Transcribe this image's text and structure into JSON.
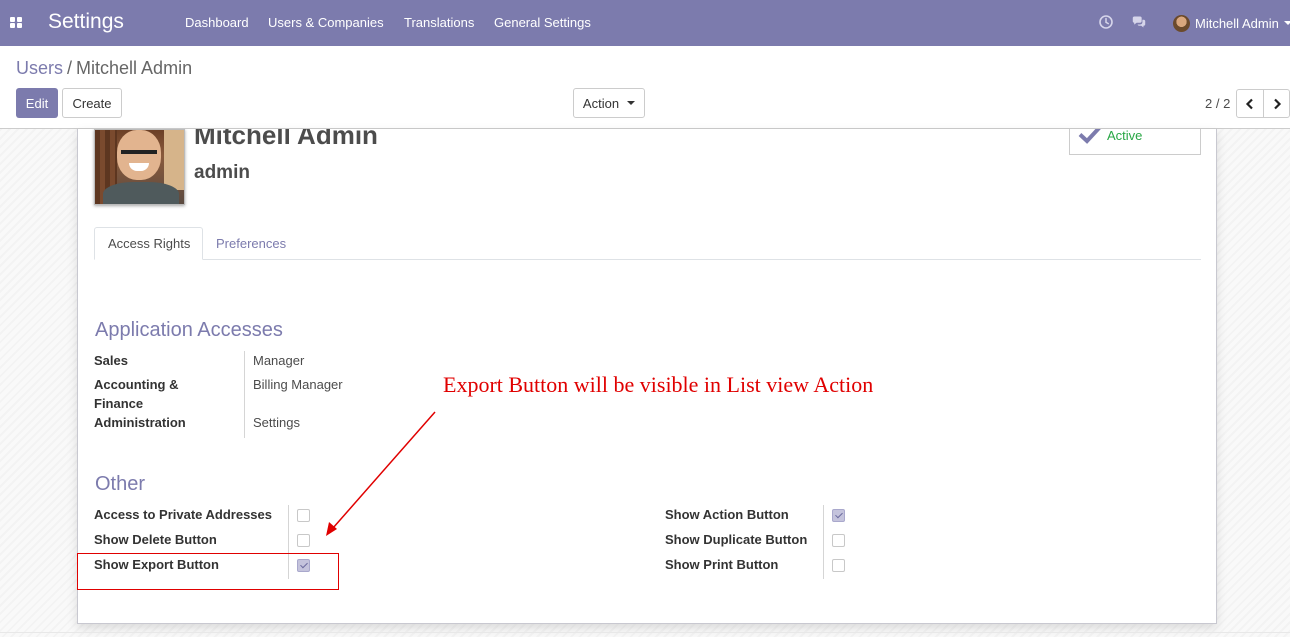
{
  "navbar": {
    "app_title": "Settings",
    "menu": [
      "Dashboard",
      "Users & Companies",
      "Translations",
      "General Settings"
    ],
    "icons": [
      "apps-grid-icon",
      "clock-icon",
      "chat-icon"
    ],
    "user": "Mitchell Admin",
    "color": "#7c7bad"
  },
  "breadcrumb": {
    "parent": "Users",
    "separator": "/",
    "current": "Mitchell Admin"
  },
  "buttons": {
    "edit": "Edit",
    "create": "Create",
    "action": "Action"
  },
  "pager": {
    "value": "2 / 2"
  },
  "record": {
    "name": "Mitchell Admin",
    "login": "admin",
    "status": "Active",
    "status_color": "#28a745"
  },
  "tabs": [
    "Access Rights",
    "Preferences"
  ],
  "application_accesses": {
    "title": "Application Accesses",
    "rows": [
      {
        "label": "Sales",
        "value": "Manager"
      },
      {
        "label": "Accounting & Finance",
        "value": "Billing Manager"
      },
      {
        "label": "Administration",
        "value": "Settings"
      }
    ]
  },
  "other": {
    "title": "Other",
    "left": [
      {
        "label": "Access to Private Addresses",
        "checked": false
      },
      {
        "label": "Show Delete Button",
        "checked": false
      },
      {
        "label": "Show Export Button",
        "checked": true
      }
    ],
    "right": [
      {
        "label": "Show Action Button",
        "checked": true
      },
      {
        "label": "Show Duplicate Button",
        "checked": false
      },
      {
        "label": "Show Print Button",
        "checked": false
      }
    ]
  },
  "annotation": {
    "text": "Export Button will be visible in List view Action",
    "color": "#e00000"
  }
}
